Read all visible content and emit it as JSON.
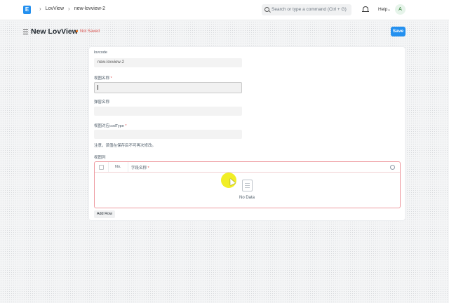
{
  "navbar": {
    "logo_letter": "E",
    "breadcrumbs": [
      "LovView",
      "new-lovview-2"
    ],
    "breadcrumb_sep": "›",
    "search_placeholder": "Search or type a command (Ctrl + G)",
    "help_label": "Help",
    "help_chevron": "⌄",
    "avatar_letter": "A"
  },
  "header": {
    "title": "New LovView",
    "status": "Not Saved",
    "save_label": "Save"
  },
  "form": {
    "fields": [
      {
        "label": "lovcode",
        "required": false,
        "value": "new-lovview-2"
      },
      {
        "label": "视图名称",
        "required": true,
        "value": ""
      },
      {
        "label": "弹窗名称",
        "required": false,
        "value": ""
      },
      {
        "label": "视图对应codType",
        "required": true,
        "value": ""
      }
    ],
    "note": "注意，该值在保存后不可再次修改。",
    "table": {
      "label": "视图列",
      "col_no": "No.",
      "col_name": "字段名称",
      "empty_text": "No Data"
    },
    "add_row_label": "Add Row"
  },
  "colors": {
    "accent": "#2490ef",
    "required": "#e24c4c",
    "error_border": "#ee9aa0",
    "cursor_highlight": "#eeeb00"
  }
}
